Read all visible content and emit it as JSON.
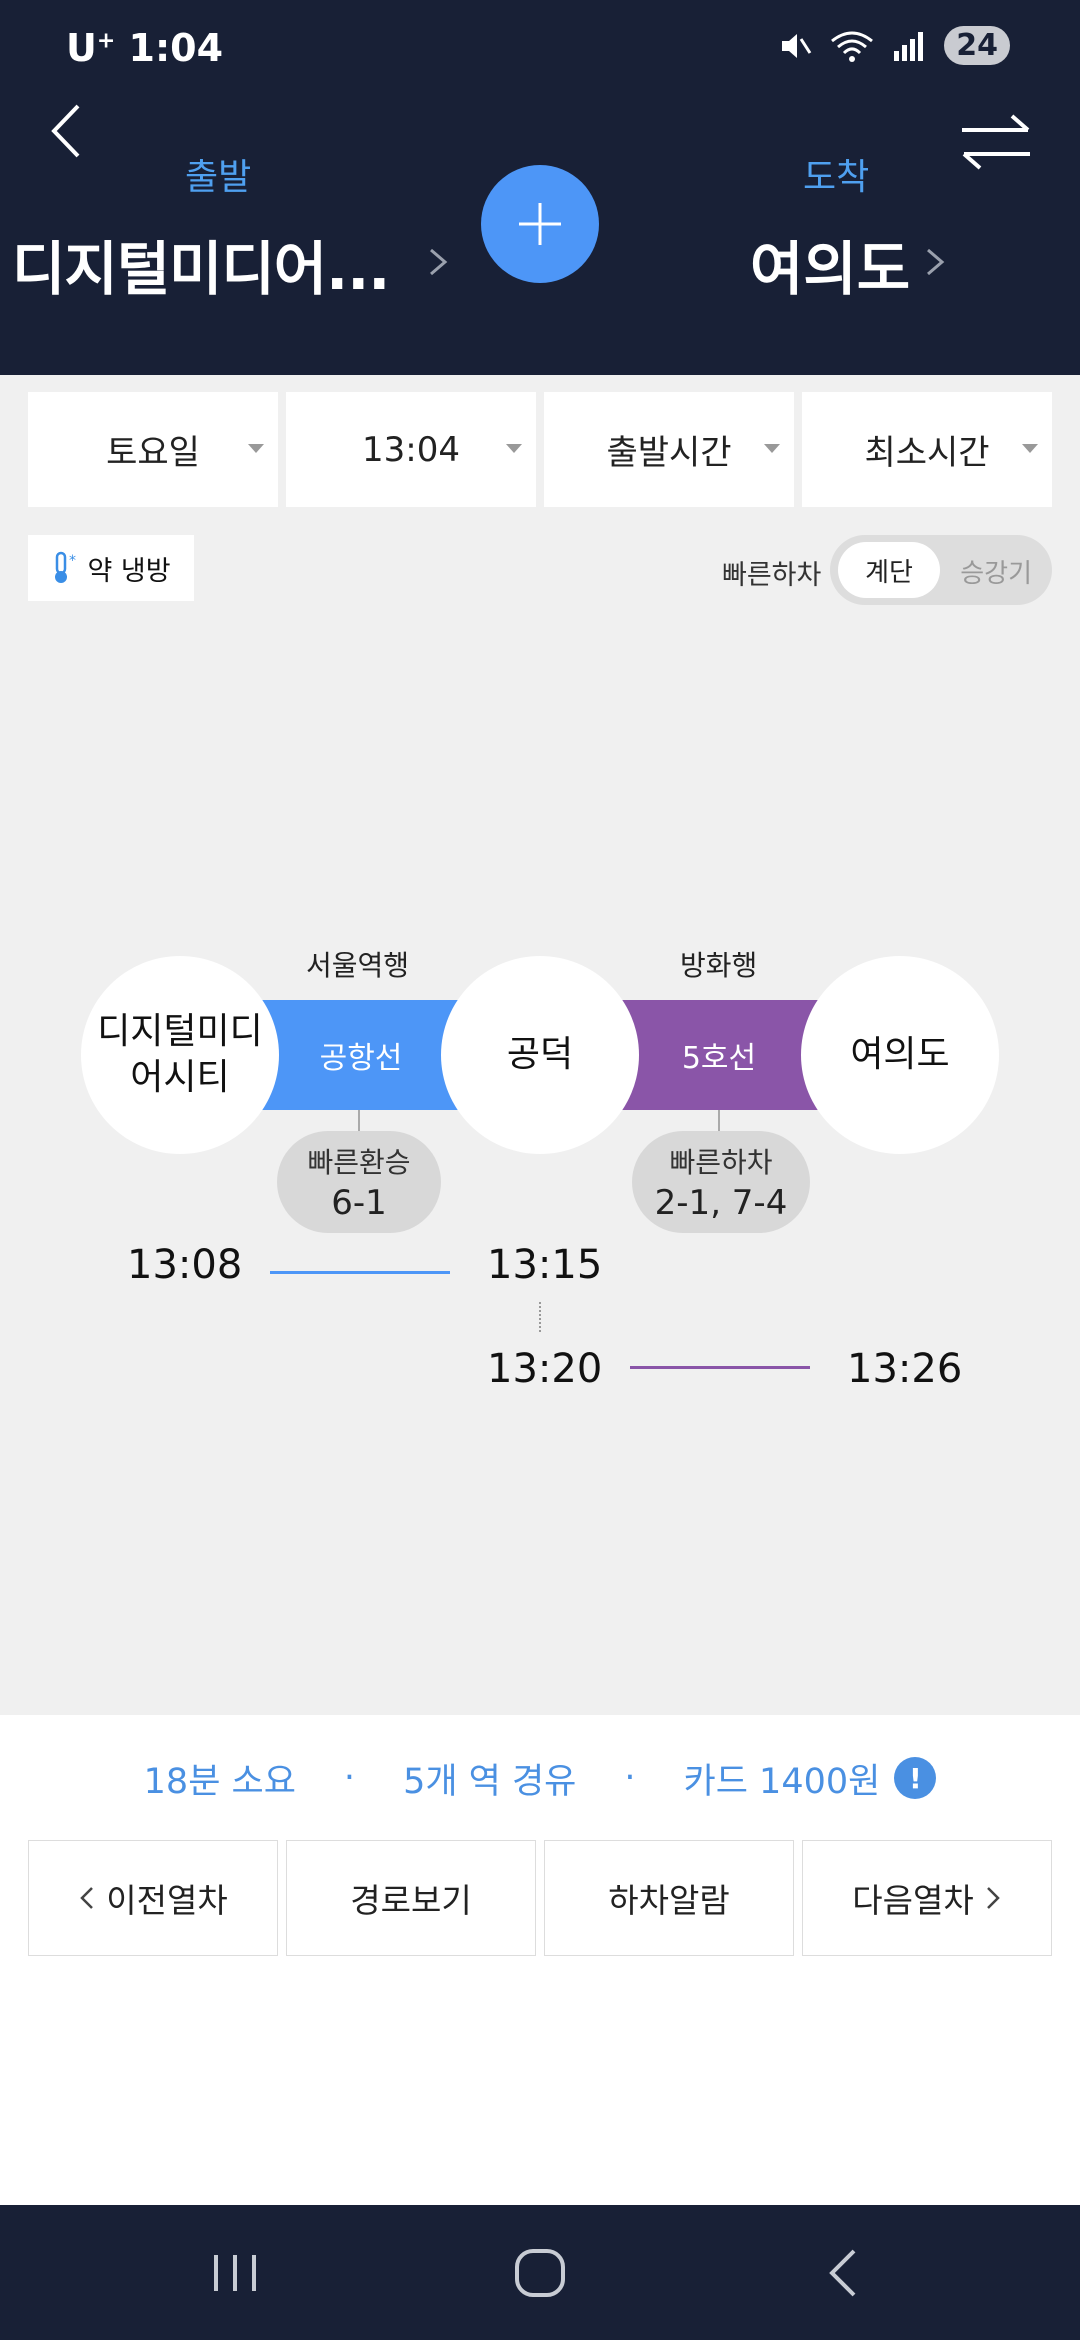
{
  "status_bar": {
    "carrier": "U",
    "carrier_sup": "+",
    "time": "1:04",
    "battery": "24"
  },
  "header": {
    "departure_label": "출발",
    "departure_station": "디지털미디어...",
    "arrival_label": "도착",
    "arrival_station": "여의도"
  },
  "filters": [
    {
      "label": "토요일"
    },
    {
      "label": "13:04"
    },
    {
      "label": "출발시간"
    },
    {
      "label": "최소시간"
    }
  ],
  "cooling_chip": {
    "label": "약 냉방"
  },
  "fast_exit": {
    "label": "빠른하차",
    "option_on": "계단",
    "option_off": "승강기"
  },
  "route": {
    "stations": [
      {
        "line1": "디지털미디",
        "line2": "어시티"
      },
      {
        "line1": "공덕"
      },
      {
        "line1": "여의도"
      }
    ],
    "segments": [
      {
        "direction": "서울역행",
        "line": "공항선",
        "color": "#4d96f7",
        "badge_title": "빠른환승",
        "badge_value": "6-1",
        "depart": "13:08",
        "arrive": "13:15"
      },
      {
        "direction": "방화행",
        "line": "5호선",
        "color": "#8a55a8",
        "badge_title": "빠른하차",
        "badge_value": "2-1, 7-4",
        "depart": "13:20",
        "arrive": "13:26"
      }
    ]
  },
  "summary": {
    "duration": "18분 소요",
    "stops": "5개 역 경유",
    "fare": "카드 1400원",
    "sep": "·"
  },
  "actions": {
    "prev": "이전열차",
    "route": "경로보기",
    "alarm": "하차알람",
    "next": "다음열차"
  },
  "colors": {
    "header_bg": "#182036",
    "accent": "#4a90e2"
  }
}
